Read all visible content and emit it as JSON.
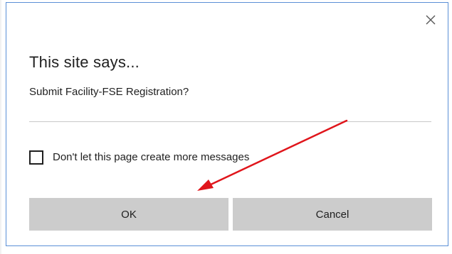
{
  "dialog": {
    "title": "This site says...",
    "message": "Submit Facility-FSE Registration?",
    "checkbox_label": "Don't let this page create more messages",
    "checkbox_checked": false,
    "buttons": {
      "ok_label": "OK",
      "cancel_label": "Cancel"
    },
    "close_icon": "close-icon"
  },
  "annotation": {
    "arrow_color": "#e0151b"
  },
  "colors": {
    "dialog_border": "#5b8fd6",
    "button_bg": "#cccccc",
    "text": "#1f1f1f",
    "divider": "#c8c8c8"
  }
}
